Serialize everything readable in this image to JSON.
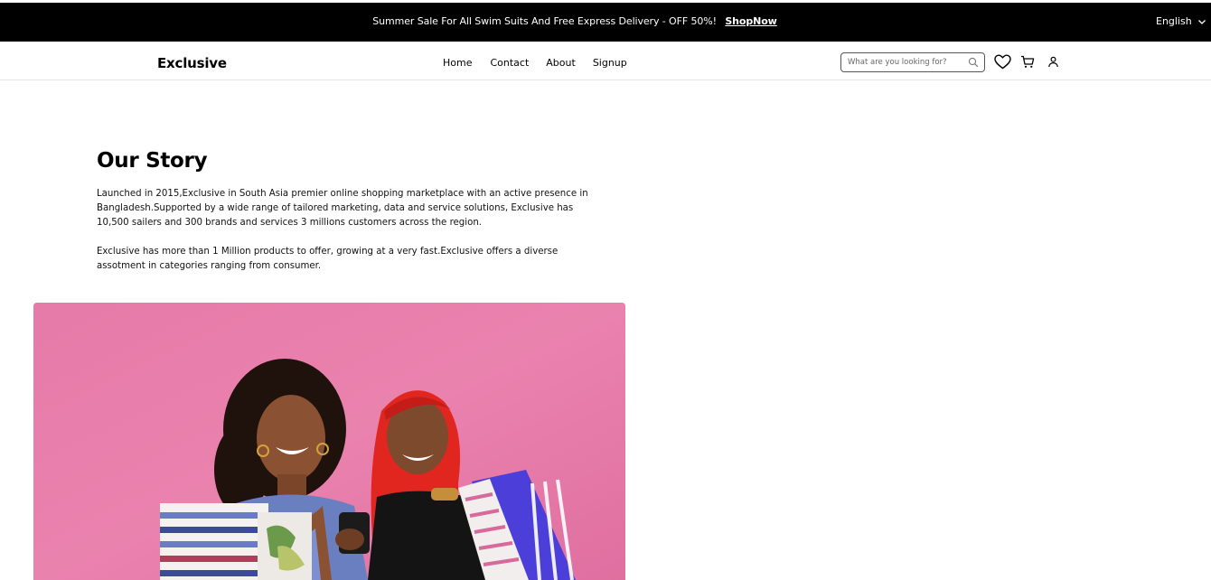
{
  "promo": {
    "message": "Summer Sale For All Swim Suits And Free Express Delivery - OFF 50%!",
    "link_label": "ShopNow",
    "language": "English"
  },
  "header": {
    "logo": "Exclusive",
    "nav": [
      "Home",
      "Contact",
      "About",
      "Signup"
    ],
    "search_placeholder": "What are you looking for?"
  },
  "story": {
    "title": "Our Story",
    "paragraph1": "Launched in 2015,Exclusive in South Asia premier online shopping marketplace with an active presence in Bangladesh.Supported by a wide range of tailored marketing, data and service solutions, Exclusive has 10,500 sailers and 300 brands and services 3 millions customers across the region.",
    "paragraph2": "Exclusive has more than 1 Million products to offer, growing at a very fast.Exclusive offers a diverse assotment in categories ranging from consumer."
  },
  "colors": {
    "promo_bg": "#000000",
    "photo_bg": "#e679a7"
  }
}
